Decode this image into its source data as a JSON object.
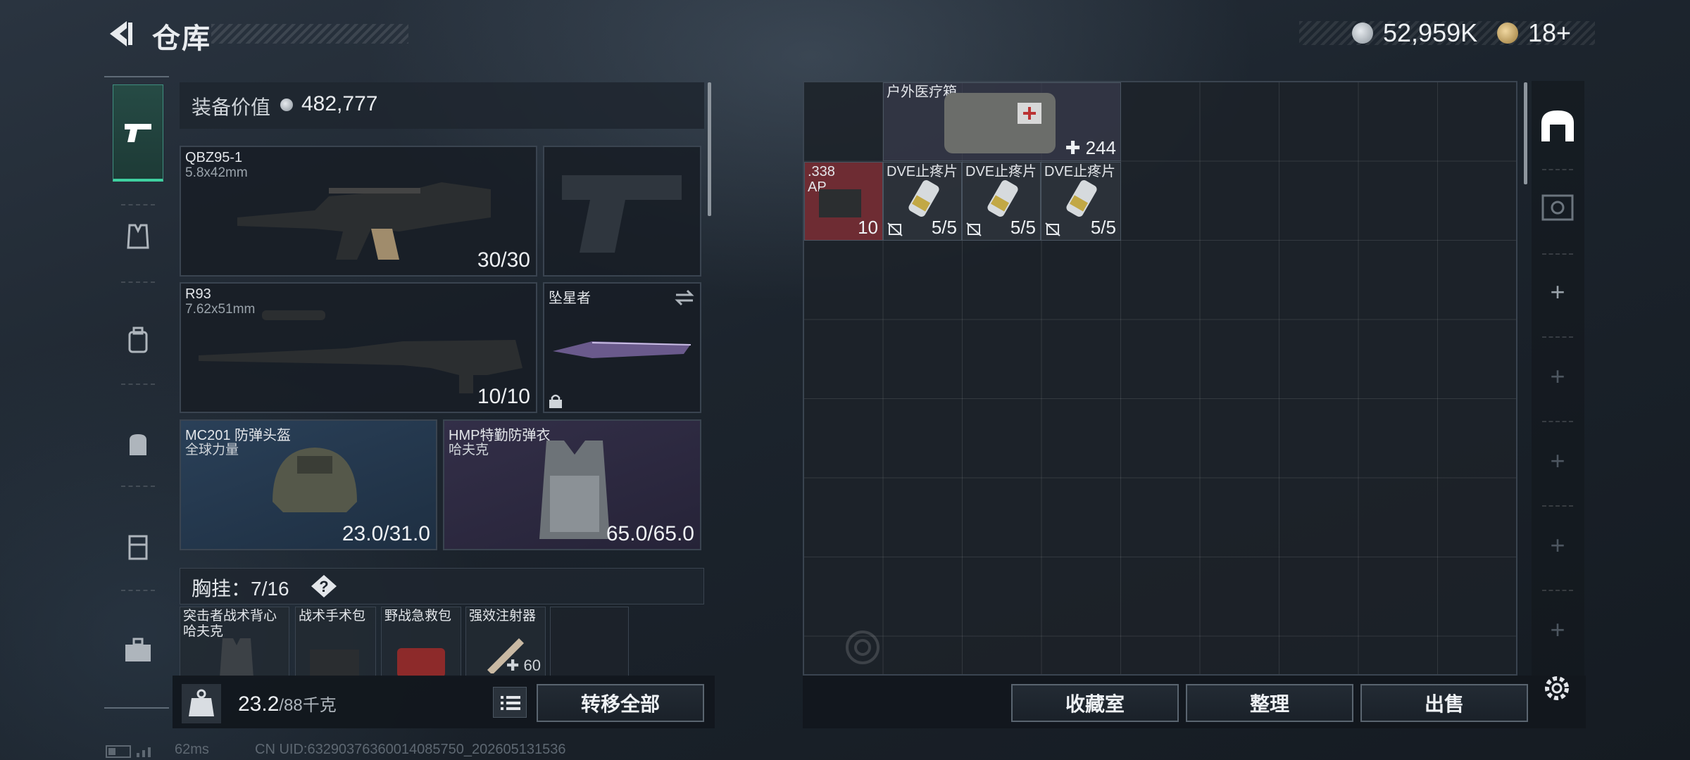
{
  "header": {
    "title": "仓库",
    "currency_main": "52,959K",
    "currency_secondary": "18+"
  },
  "equipment": {
    "value_label": "装备价值",
    "value": "482,777",
    "primary_weapon": {
      "name": "QBZ95-1",
      "caliber": "5.8x42mm",
      "ammo": "30/30"
    },
    "secondary_weapon": {
      "name": "R93",
      "caliber": "7.62x51mm",
      "ammo": "10/10"
    },
    "melee": {
      "name": "坠星者"
    },
    "helmet": {
      "name": "MC201 防弹头盔",
      "brand": "全球力量",
      "durability": "23.0/31.0"
    },
    "armor": {
      "name": "HMP特勤防弹衣",
      "brand": "哈夫克",
      "durability": "65.0/65.0"
    },
    "chest_rig": {
      "label": "胸挂：",
      "capacity": "7/16",
      "help": "?"
    },
    "chest_items": [
      {
        "name": "突击者战术背心",
        "brand": "哈夫克"
      },
      {
        "name": "战术手术包"
      },
      {
        "name": "野战急救包"
      },
      {
        "name": "强效注射器",
        "count": "60"
      }
    ]
  },
  "weight": {
    "current": "23.2",
    "max": "/88千克"
  },
  "actions": {
    "transfer_all": "转移全部",
    "collection": "收藏室",
    "organize": "整理",
    "sell": "出售"
  },
  "stash": {
    "items": [
      {
        "name": "户外医疗箱",
        "count": "244"
      },
      {
        "name": ".338 AP",
        "count": "10"
      },
      {
        "name": "DVE止疼片",
        "uses": "5/5"
      },
      {
        "name": "DVE止疼片",
        "uses": "5/5"
      },
      {
        "name": "DVE止疼片",
        "uses": "5/5"
      }
    ]
  },
  "status": {
    "ping": "62ms",
    "uid": "CN UID:6329037636001408575​0_202605131536"
  },
  "colors": {
    "accent_green": "#3fd0a0",
    "ammo_red": "#7a2e34",
    "blue_rarity": "#2a4058",
    "purple_rarity": "#332f48"
  }
}
